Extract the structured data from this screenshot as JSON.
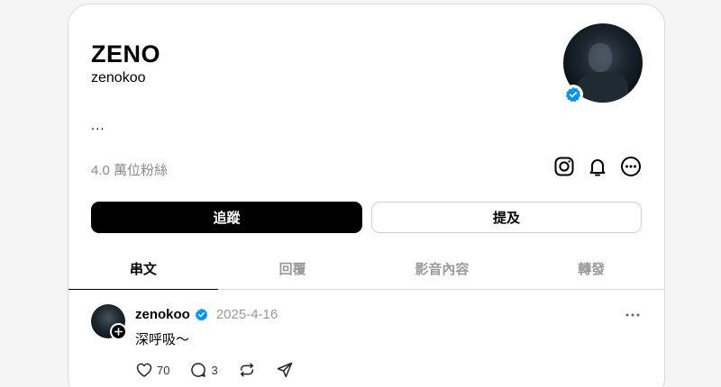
{
  "profile": {
    "display_name": "ZENO",
    "username": "zenokoo",
    "bio": "...",
    "followers": "4.0 萬位粉絲"
  },
  "buttons": {
    "follow": "追蹤",
    "mention": "提及"
  },
  "tabs": [
    {
      "label": "串文",
      "active": true
    },
    {
      "label": "回覆",
      "active": false
    },
    {
      "label": "影音內容",
      "active": false
    },
    {
      "label": "轉發",
      "active": false
    }
  ],
  "icons": {
    "instagram": "instagram-icon",
    "notifications": "bell-icon",
    "more": "more-circle-icon",
    "verified": "verified-badge-icon",
    "like": "heart-icon",
    "reply": "comment-icon",
    "repost": "repost-icon",
    "share": "send-icon"
  },
  "post": {
    "user": "zenokoo",
    "date": "2025-4-16",
    "text": "深呼吸～",
    "likes": "70",
    "replies": "3"
  },
  "colors": {
    "verified": "#0095f6",
    "muted_text": "#999999",
    "follow_button_bg": "#000000"
  }
}
